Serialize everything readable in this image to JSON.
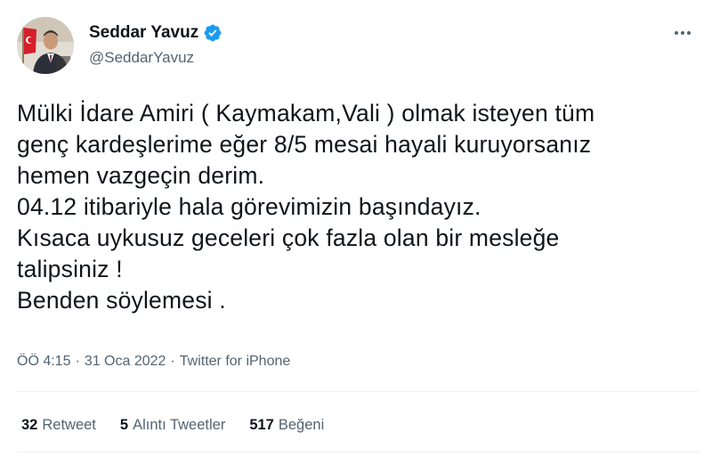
{
  "author": {
    "display_name": "Seddar Yavuz",
    "handle": "@SeddarYavuz",
    "verified": true,
    "verified_color": "#1d9bf0"
  },
  "tweet": {
    "lines": [
      "Mülki İdare Amiri ( Kaymakam,Vali ) olmak isteyen tüm",
      "genç kardeşlerime eğer 8/5 mesai hayali kuruyorsanız",
      "hemen vazgeçin derim.",
      "04.12 itibariyle hala görevimizin başındayız.",
      "Kısaca uykusuz geceleri çok fazla olan bir mesleğe",
      "talipsiniz !",
      "Benden söylemesi ."
    ]
  },
  "meta": {
    "time": "ÖÖ 4:15",
    "separator": "·",
    "date": "31 Oca 2022",
    "source": "Twitter for iPhone"
  },
  "stats": {
    "retweets_count": "32",
    "retweets_label": "Retweet",
    "quotes_count": "5",
    "quotes_label": "Alıntı Tweetler",
    "likes_count": "517",
    "likes_label": "Beğeni"
  },
  "icons": {
    "more": "more-horizontal-icon",
    "verified": "verified-badge-icon"
  }
}
